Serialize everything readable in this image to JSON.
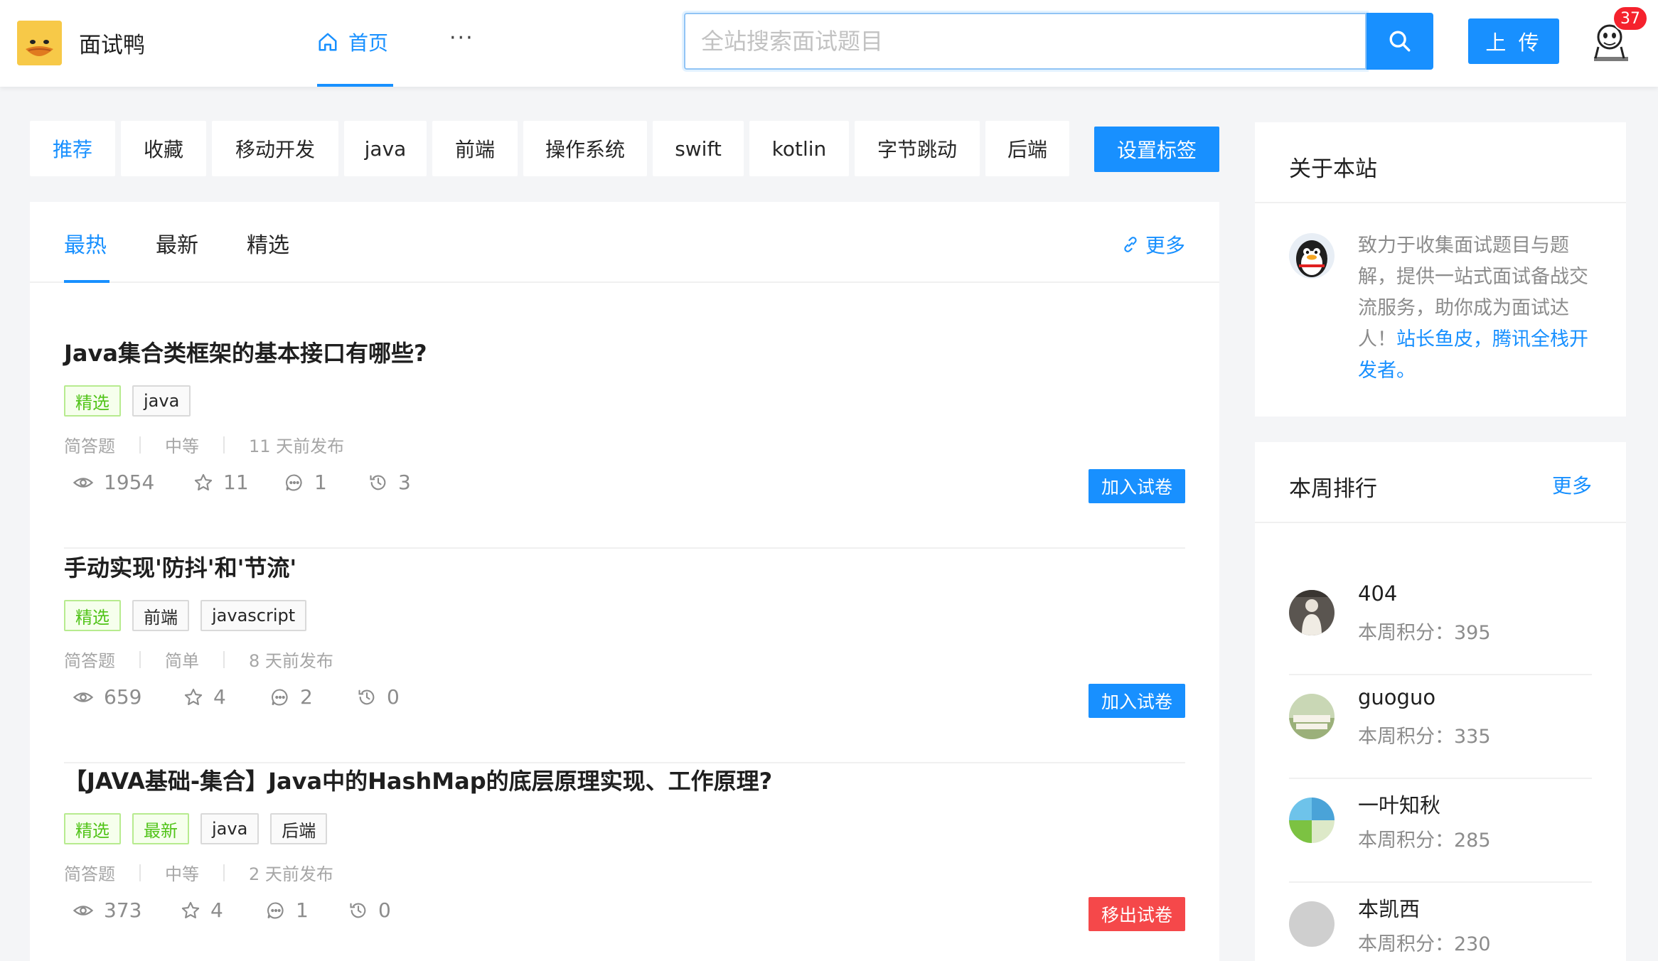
{
  "header": {
    "site_name": "面试鸭",
    "nav_home": "首页",
    "nav_more": "···",
    "search_placeholder": "全站搜索面试题目",
    "upload_label": "上 传",
    "notification_count": "37"
  },
  "tag_tabs": [
    {
      "label": "推荐",
      "active": true
    },
    {
      "label": "收藏"
    },
    {
      "label": "移动开发"
    },
    {
      "label": "java"
    },
    {
      "label": "前端"
    },
    {
      "label": "操作系统"
    },
    {
      "label": "swift"
    },
    {
      "label": "kotlin"
    },
    {
      "label": "字节跳动"
    },
    {
      "label": "后端"
    }
  ],
  "set_tags_label": "设置标签",
  "sort_tabs": [
    {
      "label": "最热",
      "active": true
    },
    {
      "label": "最新"
    },
    {
      "label": "精选"
    }
  ],
  "more_label": "更多",
  "questions": [
    {
      "title": "Java集合类框架的基本接口有哪些?",
      "tags": [
        {
          "label": "精选",
          "style": "green"
        },
        {
          "label": "java",
          "style": "plain"
        }
      ],
      "type": "简答题",
      "difficulty": "中等",
      "published": "11 天前发布",
      "views": "1954",
      "stars": "11",
      "comments": "1",
      "history": "3",
      "action": "加入试卷",
      "action_style": "blue"
    },
    {
      "title": "手动实现'防抖'和'节流'",
      "tags": [
        {
          "label": "精选",
          "style": "green"
        },
        {
          "label": "前端",
          "style": "plain"
        },
        {
          "label": "javascript",
          "style": "plain"
        }
      ],
      "type": "简答题",
      "difficulty": "简单",
      "published": "8 天前发布",
      "views": "659",
      "stars": "4",
      "comments": "2",
      "history": "0",
      "action": "加入试卷",
      "action_style": "blue"
    },
    {
      "title": "【JAVA基础-集合】Java中的HashMap的底层原理实现、工作原理?",
      "tags": [
        {
          "label": "精选",
          "style": "green"
        },
        {
          "label": "最新",
          "style": "green"
        },
        {
          "label": "java",
          "style": "plain"
        },
        {
          "label": "后端",
          "style": "plain"
        }
      ],
      "type": "简答题",
      "difficulty": "中等",
      "published": "2 天前发布",
      "views": "373",
      "stars": "4",
      "comments": "1",
      "history": "0",
      "action": "移出试卷",
      "action_style": "red"
    }
  ],
  "about": {
    "title": "关于本站",
    "text": "致力于收集面试题目与题解，提供一站式面试备战交流服务，助你成为面试达人！",
    "link_text": "站长鱼皮，腾讯全栈开发者。"
  },
  "ranking": {
    "title": "本周排行",
    "more_label": "更多",
    "score_prefix": "本周积分：",
    "items": [
      {
        "name": "404",
        "score": "本周积分：395"
      },
      {
        "name": "guoguo",
        "score": "本周积分：335"
      },
      {
        "name": "一叶知秋",
        "score": "本周积分：285"
      },
      {
        "name": "本凯西",
        "score": "本周积分：230"
      }
    ]
  },
  "colors": {
    "primary": "#1890ff",
    "danger": "#f5484a",
    "green_tag": "#52c41a",
    "background": "#f4f5f7"
  }
}
